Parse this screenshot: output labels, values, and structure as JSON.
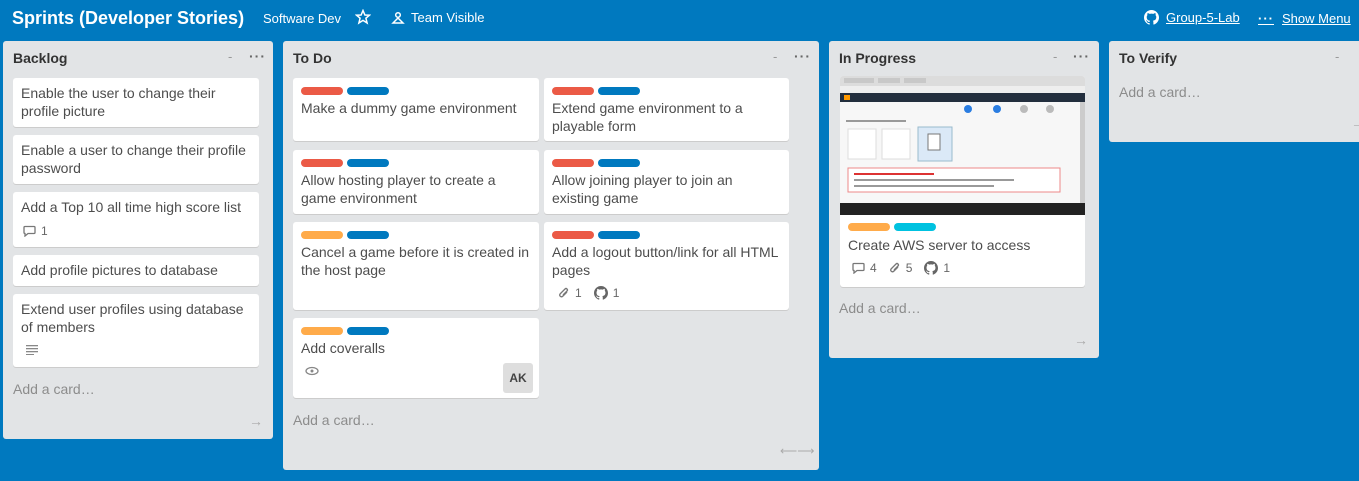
{
  "header": {
    "board_title": "Sprints (Developer Stories)",
    "org": "Software Dev",
    "visibility": "Team Visible",
    "team": "Group-5-Lab",
    "show_menu": "Show Menu",
    "more": "···"
  },
  "colors": {
    "red": "#eb5a46",
    "blue": "#0079bf",
    "orange": "#ffab4a",
    "sky": "#00c2e0"
  },
  "lists": {
    "backlog": {
      "title": "Backlog",
      "min": "-",
      "more": "···",
      "add": "Add a card…",
      "arrow": "→",
      "cards": [
        {
          "text": "Enable the user to change their profile picture"
        },
        {
          "text": "Enable a user to change their profile password"
        },
        {
          "text": "Add a Top 10 all time high score list",
          "comments": "1"
        },
        {
          "text": "Add profile pictures to database"
        },
        {
          "text": "Extend user profiles using database of members"
        }
      ]
    },
    "todo": {
      "title": "To Do",
      "min": "-",
      "more": "···",
      "add": "Add a card…",
      "arrow": "⟵⟶",
      "cards": [
        {
          "text": "Make a dummy game environment"
        },
        {
          "text": "Extend game environment to a playable form"
        },
        {
          "text": "Allow hosting player to create a game environment"
        },
        {
          "text": "Allow joining player to join an existing game"
        },
        {
          "text": "Cancel a game before it is created in the host page"
        },
        {
          "text": "Add a logout button/link for all HTML pages",
          "attachments": "1",
          "github": "1"
        },
        {
          "text": "Add coveralls",
          "avatar": "AK"
        }
      ]
    },
    "inprogress": {
      "title": "In Progress",
      "min": "-",
      "more": "···",
      "add": "Add a card…",
      "arrow": "→",
      "cards": [
        {
          "text": "Create AWS server to access",
          "comments": "4",
          "attachments": "5",
          "github": "1"
        }
      ]
    },
    "toverify": {
      "title": "To Verify",
      "min": "-",
      "add": "Add a card…",
      "arrow": "→"
    }
  }
}
